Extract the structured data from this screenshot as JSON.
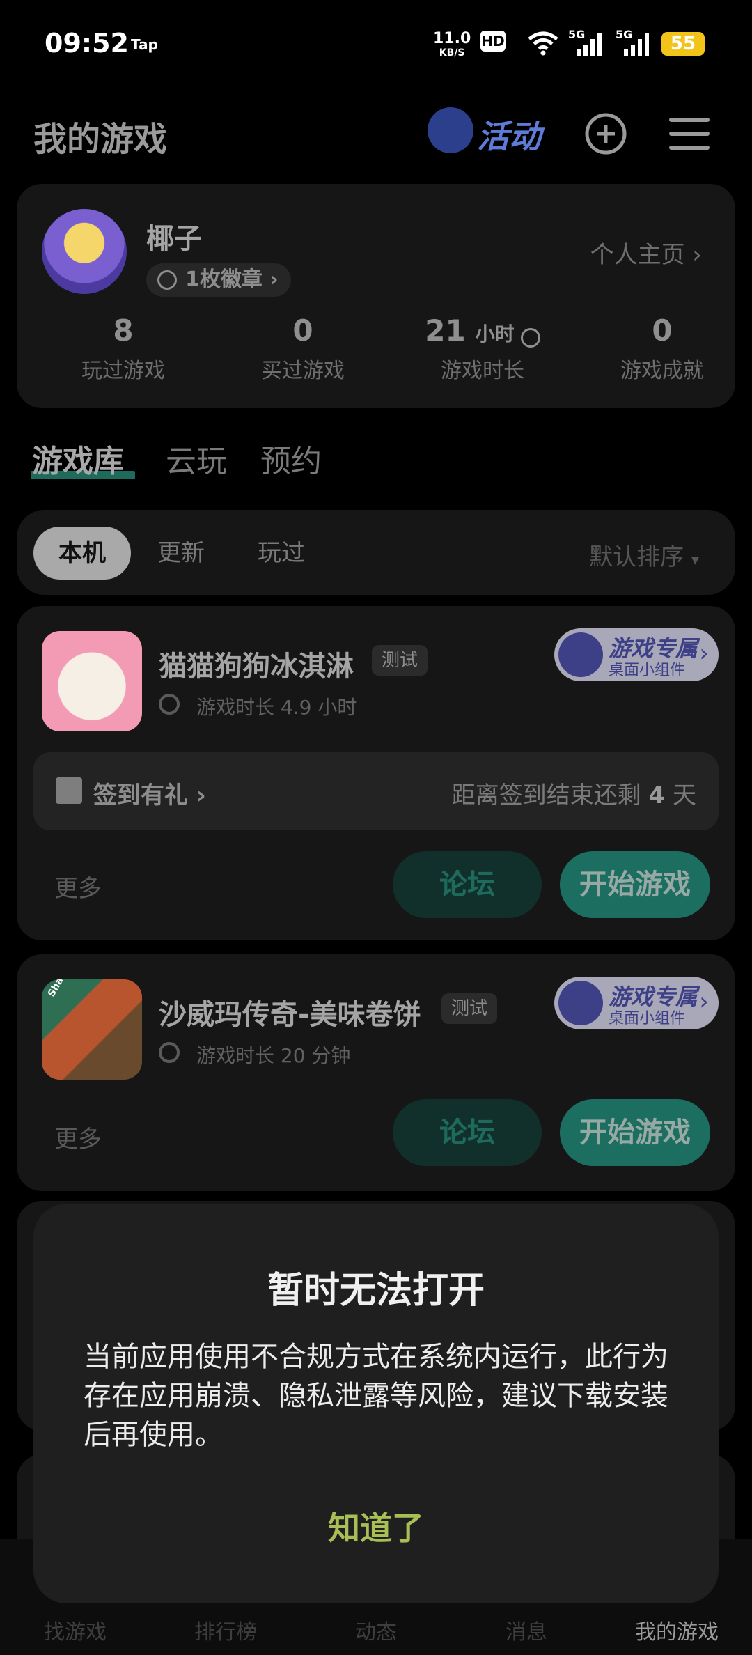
{
  "status_bar": {
    "time": "09:52",
    "app_tag": "Tap",
    "net_speed": "11.0",
    "net_unit": "KB/S",
    "hd": "HD",
    "signal1": "5G",
    "signal2": "5G",
    "battery": "55"
  },
  "header": {
    "title": "我的游戏",
    "activity_label": "活动"
  },
  "profile": {
    "username": "椰子",
    "badge_label": "1枚徽章",
    "homepage_link": "个人主页",
    "stats": [
      {
        "value": "8",
        "unit": "",
        "label": "玩过游戏"
      },
      {
        "value": "0",
        "unit": "",
        "label": "买过游戏"
      },
      {
        "value": "21",
        "unit": "小时",
        "label": "游戏时长"
      },
      {
        "value": "0",
        "unit": "",
        "label": "游戏成就"
      }
    ]
  },
  "library_tabs": [
    "游戏库",
    "云玩",
    "预约"
  ],
  "filters": {
    "chips": [
      "本机",
      "更新",
      "玩过"
    ],
    "sort": "默认排序"
  },
  "games": [
    {
      "name": "猫猫狗狗冰淇淋",
      "tag": "测试",
      "playtime": "游戏时长 4.9 小时",
      "widget_title": "游戏专属",
      "widget_sub": "桌面小组件",
      "signin_label": "签到有礼",
      "signin_remain_prefix": "距离签到结束还剩",
      "signin_remain_days": "4",
      "signin_remain_suffix": "天",
      "more": "更多",
      "forum": "论坛",
      "start": "开始游戏"
    },
    {
      "name": "沙威玛传奇-美味卷饼",
      "tag": "测试",
      "playtime": "游戏时长 20 分钟",
      "widget_title": "游戏专属",
      "widget_sub": "桌面小组件",
      "icon_text": "Shawarma",
      "more": "更多",
      "forum": "论坛",
      "start": "开始游戏"
    }
  ],
  "bottom_nav": [
    "找游戏",
    "排行榜",
    "动态",
    "消息",
    "我的游戏"
  ],
  "dialog": {
    "title": "暂时无法打开",
    "message": "当前应用使用不合规方式在系统内运行，此行为存在应用崩溃、隐私泄露等风险，建议下载安装后再使用。",
    "confirm": "知道了"
  },
  "colors": {
    "accent_green": "#1c6e61",
    "dialog_confirm": "#a9bf55",
    "battery": "#f2c318"
  }
}
